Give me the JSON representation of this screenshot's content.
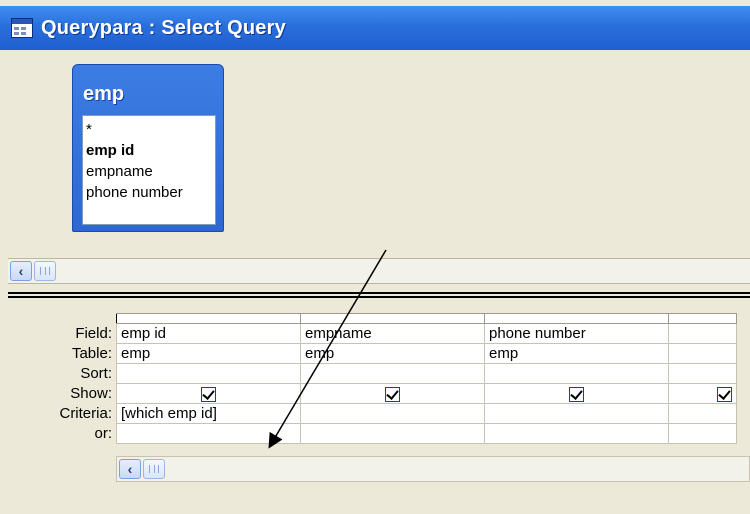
{
  "window": {
    "title": "Querypara : Select Query",
    "icon": "query-icon"
  },
  "table_box": {
    "title": "emp",
    "fields": [
      "*",
      "emp id",
      "empname",
      "phone number"
    ],
    "bold_field_index": 1
  },
  "grid": {
    "row_labels": [
      "Field:",
      "Table:",
      "Sort:",
      "Show:",
      "Criteria:",
      "or:"
    ],
    "columns": [
      {
        "field": "emp id",
        "table": "emp",
        "sort": "",
        "show": true,
        "criteria": "[which emp id]",
        "or": ""
      },
      {
        "field": "empname",
        "table": "emp",
        "sort": "",
        "show": true,
        "criteria": "",
        "or": ""
      },
      {
        "field": "phone number",
        "table": "emp",
        "sort": "",
        "show": true,
        "criteria": "",
        "or": ""
      },
      {
        "field": "",
        "table": "",
        "sort": "",
        "show": true,
        "criteria": "",
        "or": ""
      }
    ]
  },
  "scroll": {
    "left_arrow": "‹"
  },
  "colors": {
    "titlebar": "#2a6fdc",
    "table_box": "#2f67d2",
    "background": "#ece9d8"
  }
}
